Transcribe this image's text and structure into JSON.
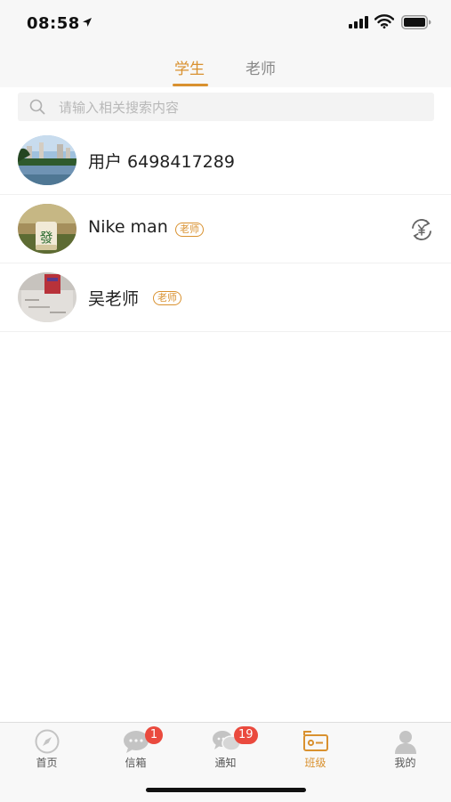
{
  "status_bar": {
    "time": "08:58"
  },
  "tabs": [
    {
      "label": "学生",
      "active": true
    },
    {
      "label": "老师",
      "active": false
    }
  ],
  "search": {
    "placeholder": "请输入相关搜索内容",
    "value": ""
  },
  "members": [
    {
      "name": "用户 6498417289",
      "badge": "",
      "avatar": "city-lake-photo"
    },
    {
      "name": "Nike man",
      "badge": "老师",
      "avatar": "mahjong-tile-photo",
      "action_icon": "yuan-exchange-icon"
    },
    {
      "name": "吴老师",
      "badge": "老师",
      "avatar": "desk-photo"
    }
  ],
  "tabbar": [
    {
      "label": "首页",
      "icon": "compass-icon",
      "badge": ""
    },
    {
      "label": "信箱",
      "icon": "chat-bubble-icon",
      "badge": "1"
    },
    {
      "label": "通知",
      "icon": "double-chat-icon",
      "badge": "19"
    },
    {
      "label": "班级",
      "icon": "class-card-icon",
      "badge": "",
      "active": true
    },
    {
      "label": "我的",
      "icon": "person-icon",
      "badge": ""
    }
  ],
  "colors": {
    "accent": "#d9912f",
    "badge": "#ea4a3e"
  }
}
